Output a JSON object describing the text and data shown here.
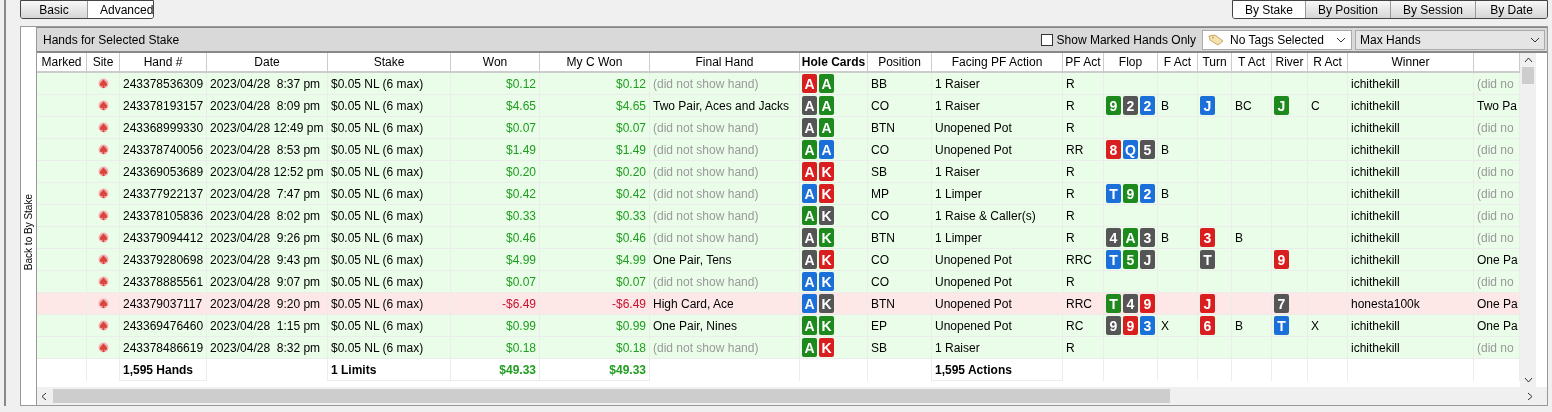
{
  "view_tabs": [
    {
      "label": "Basic",
      "selected": false
    },
    {
      "label": "Advanced",
      "selected": true
    }
  ],
  "group_tabs": [
    {
      "label": "By Stake",
      "selected": true
    },
    {
      "label": "By Position",
      "selected": false
    },
    {
      "label": "By Session",
      "selected": false
    },
    {
      "label": "By Date",
      "selected": false
    }
  ],
  "back_button": "Back to By Stake",
  "panel_title": "Hands for Selected Stake",
  "marked_only": {
    "label": "Show Marked Hands Only",
    "checked": false
  },
  "tags_dropdown": "No Tags Selected",
  "limit_dropdown": "Max Hands",
  "columns": [
    {
      "label": "Marked",
      "sorted": false
    },
    {
      "label": "Site",
      "sorted": false
    },
    {
      "label": "Hand #",
      "sorted": false
    },
    {
      "label": "Date",
      "sorted": false
    },
    {
      "label": "Stake",
      "sorted": false
    },
    {
      "label": "Won",
      "sorted": false
    },
    {
      "label": "My C Won",
      "sorted": false
    },
    {
      "label": "Final Hand",
      "sorted": false
    },
    {
      "label": "Hole Cards",
      "sorted": true
    },
    {
      "label": "Position",
      "sorted": false
    },
    {
      "label": "Facing PF Action",
      "sorted": false
    },
    {
      "label": "PF Act",
      "sorted": false
    },
    {
      "label": "Flop",
      "sorted": false
    },
    {
      "label": "F Act",
      "sorted": false
    },
    {
      "label": "Turn",
      "sorted": false
    },
    {
      "label": "T Act",
      "sorted": false
    },
    {
      "label": "River",
      "sorted": false
    },
    {
      "label": "R Act",
      "sorted": false
    },
    {
      "label": "Winner",
      "sorted": false
    }
  ],
  "rows": [
    {
      "lost": false,
      "hand": "243378536309",
      "date": "2023/04/28  8:37 pm",
      "stake": "$0.05 NL (6 max)",
      "won": "$0.12",
      "my_c_won": "$0.12",
      "final_hand": "(did not show hand)",
      "shown": false,
      "hole_cards": [
        {
          "rank": "A",
          "color": "#d81e1e"
        },
        {
          "rank": "A",
          "color": "#1e8a1e"
        }
      ],
      "position": "BB",
      "facing": "1 Raiser",
      "pf_act": "R",
      "flop": [],
      "f_act": "",
      "turn": [],
      "t_act": "",
      "river": [],
      "r_act": "",
      "winner": "ichithekill",
      "column_20": "(did no"
    },
    {
      "lost": false,
      "hand": "243378193157",
      "date": "2023/04/28  8:09 pm",
      "stake": "$0.05 NL (6 max)",
      "won": "$4.65",
      "my_c_won": "$4.65",
      "final_hand": "Two Pair, Aces and Jacks",
      "shown": true,
      "hole_cards": [
        {
          "rank": "A",
          "color": "#555555"
        },
        {
          "rank": "A",
          "color": "#1e8a1e"
        }
      ],
      "position": "CO",
      "facing": "1 Raiser",
      "pf_act": "R",
      "flop": [
        {
          "rank": "9",
          "color": "#1e8a1e"
        },
        {
          "rank": "2",
          "color": "#555555"
        },
        {
          "rank": "2",
          "color": "#1b6fd8"
        }
      ],
      "f_act": "B",
      "turn": [
        {
          "rank": "J",
          "color": "#1b6fd8"
        }
      ],
      "t_act": "BC",
      "river": [
        {
          "rank": "J",
          "color": "#1e8a1e"
        }
      ],
      "r_act": "C",
      "winner": "ichithekill",
      "column_20": "Two Pa"
    },
    {
      "lost": false,
      "hand": "243368999330",
      "date": "2023/04/28 12:49 pm",
      "stake": "$0.05 NL (6 max)",
      "won": "$0.07",
      "my_c_won": "$0.07",
      "final_hand": "(did not show hand)",
      "shown": false,
      "hole_cards": [
        {
          "rank": "A",
          "color": "#555555"
        },
        {
          "rank": "A",
          "color": "#1e8a1e"
        }
      ],
      "position": "BTN",
      "facing": "Unopened Pot",
      "pf_act": "R",
      "flop": [],
      "f_act": "",
      "turn": [],
      "t_act": "",
      "river": [],
      "r_act": "",
      "winner": "ichithekill",
      "column_20": "(did no"
    },
    {
      "lost": false,
      "hand": "243378740056",
      "date": "2023/04/28  8:53 pm",
      "stake": "$0.05 NL (6 max)",
      "won": "$1.49",
      "my_c_won": "$1.49",
      "final_hand": "(did not show hand)",
      "shown": false,
      "hole_cards": [
        {
          "rank": "A",
          "color": "#1e8a1e"
        },
        {
          "rank": "A",
          "color": "#1b6fd8"
        }
      ],
      "position": "CO",
      "facing": "Unopened Pot",
      "pf_act": "RR",
      "flop": [
        {
          "rank": "8",
          "color": "#d81e1e"
        },
        {
          "rank": "Q",
          "color": "#1b6fd8"
        },
        {
          "rank": "5",
          "color": "#555555"
        }
      ],
      "f_act": "B",
      "turn": [],
      "t_act": "",
      "river": [],
      "r_act": "",
      "winner": "ichithekill",
      "column_20": "(did no"
    },
    {
      "lost": false,
      "hand": "243369053689",
      "date": "2023/04/28 12:52 pm",
      "stake": "$0.05 NL (6 max)",
      "won": "$0.20",
      "my_c_won": "$0.20",
      "final_hand": "(did not show hand)",
      "shown": false,
      "hole_cards": [
        {
          "rank": "A",
          "color": "#d81e1e"
        },
        {
          "rank": "K",
          "color": "#d81e1e"
        }
      ],
      "position": "SB",
      "facing": "1 Raiser",
      "pf_act": "R",
      "flop": [],
      "f_act": "",
      "turn": [],
      "t_act": "",
      "river": [],
      "r_act": "",
      "winner": "ichithekill",
      "column_20": "(did no"
    },
    {
      "lost": false,
      "hand": "243377922137",
      "date": "2023/04/28  7:47 pm",
      "stake": "$0.05 NL (6 max)",
      "won": "$0.42",
      "my_c_won": "$0.42",
      "final_hand": "(did not show hand)",
      "shown": false,
      "hole_cards": [
        {
          "rank": "A",
          "color": "#1b6fd8"
        },
        {
          "rank": "K",
          "color": "#d81e1e"
        }
      ],
      "position": "MP",
      "facing": "1 Limper",
      "pf_act": "R",
      "flop": [
        {
          "rank": "T",
          "color": "#1b6fd8"
        },
        {
          "rank": "9",
          "color": "#1e8a1e"
        },
        {
          "rank": "2",
          "color": "#1b6fd8"
        }
      ],
      "f_act": "B",
      "turn": [],
      "t_act": "",
      "river": [],
      "r_act": "",
      "winner": "ichithekill",
      "column_20": "(did no"
    },
    {
      "lost": false,
      "hand": "243378105836",
      "date": "2023/04/28  8:02 pm",
      "stake": "$0.05 NL (6 max)",
      "won": "$0.33",
      "my_c_won": "$0.33",
      "final_hand": "(did not show hand)",
      "shown": false,
      "hole_cards": [
        {
          "rank": "A",
          "color": "#1e8a1e"
        },
        {
          "rank": "K",
          "color": "#555555"
        }
      ],
      "position": "CO",
      "facing": "1 Raise & Caller(s)",
      "pf_act": "R",
      "flop": [],
      "f_act": "",
      "turn": [],
      "t_act": "",
      "river": [],
      "r_act": "",
      "winner": "ichithekill",
      "column_20": "(did no"
    },
    {
      "lost": false,
      "hand": "243379094412",
      "date": "2023/04/28  9:26 pm",
      "stake": "$0.05 NL (6 max)",
      "won": "$0.46",
      "my_c_won": "$0.46",
      "final_hand": "(did not show hand)",
      "shown": false,
      "hole_cards": [
        {
          "rank": "A",
          "color": "#555555"
        },
        {
          "rank": "K",
          "color": "#1e8a1e"
        }
      ],
      "position": "BTN",
      "facing": "1 Limper",
      "pf_act": "R",
      "flop": [
        {
          "rank": "4",
          "color": "#555555"
        },
        {
          "rank": "A",
          "color": "#1e8a1e"
        },
        {
          "rank": "3",
          "color": "#555555"
        }
      ],
      "f_act": "B",
      "turn": [
        {
          "rank": "3",
          "color": "#d81e1e"
        }
      ],
      "t_act": "B",
      "river": [],
      "r_act": "",
      "winner": "ichithekill",
      "column_20": "(did no"
    },
    {
      "lost": false,
      "hand": "243379280698",
      "date": "2023/04/28  9:43 pm",
      "stake": "$0.05 NL (6 max)",
      "won": "$4.99",
      "my_c_won": "$4.99",
      "final_hand": "One Pair, Tens",
      "shown": true,
      "hole_cards": [
        {
          "rank": "A",
          "color": "#555555"
        },
        {
          "rank": "K",
          "color": "#d81e1e"
        }
      ],
      "position": "CO",
      "facing": "Unopened Pot",
      "pf_act": "RRC",
      "flop": [
        {
          "rank": "T",
          "color": "#1b6fd8"
        },
        {
          "rank": "5",
          "color": "#1e8a1e"
        },
        {
          "rank": "J",
          "color": "#555555"
        }
      ],
      "f_act": "",
      "turn": [
        {
          "rank": "T",
          "color": "#555555"
        }
      ],
      "t_act": "",
      "river": [
        {
          "rank": "9",
          "color": "#d81e1e"
        }
      ],
      "r_act": "",
      "winner": "ichithekill",
      "column_20": "One Pa"
    },
    {
      "lost": false,
      "hand": "243378885561",
      "date": "2023/04/28  9:07 pm",
      "stake": "$0.05 NL (6 max)",
      "won": "$0.07",
      "my_c_won": "$0.07",
      "final_hand": "(did not show hand)",
      "shown": false,
      "hole_cards": [
        {
          "rank": "A",
          "color": "#1b6fd8"
        },
        {
          "rank": "K",
          "color": "#1b6fd8"
        }
      ],
      "position": "CO",
      "facing": "Unopened Pot",
      "pf_act": "R",
      "flop": [],
      "f_act": "",
      "turn": [],
      "t_act": "",
      "river": [],
      "r_act": "",
      "winner": "ichithekill",
      "column_20": "(did no"
    },
    {
      "lost": true,
      "hand": "243379037117",
      "date": "2023/04/28  9:20 pm",
      "stake": "$0.05 NL (6 max)",
      "won": "-$6.49",
      "my_c_won": "-$6.49",
      "final_hand": "High Card, Ace",
      "shown": true,
      "hole_cards": [
        {
          "rank": "A",
          "color": "#1b6fd8"
        },
        {
          "rank": "K",
          "color": "#555555"
        }
      ],
      "position": "BTN",
      "facing": "Unopened Pot",
      "pf_act": "RRC",
      "flop": [
        {
          "rank": "T",
          "color": "#1e8a1e"
        },
        {
          "rank": "4",
          "color": "#555555"
        },
        {
          "rank": "9",
          "color": "#d81e1e"
        }
      ],
      "f_act": "",
      "turn": [
        {
          "rank": "J",
          "color": "#d81e1e"
        }
      ],
      "t_act": "",
      "river": [
        {
          "rank": "7",
          "color": "#555555"
        }
      ],
      "r_act": "",
      "winner": "honesta100k",
      "column_20": "One Pa"
    },
    {
      "lost": false,
      "hand": "243369476460",
      "date": "2023/04/28  1:15 pm",
      "stake": "$0.05 NL (6 max)",
      "won": "$0.99",
      "my_c_won": "$0.99",
      "final_hand": "One Pair, Nines",
      "shown": true,
      "hole_cards": [
        {
          "rank": "A",
          "color": "#1e8a1e"
        },
        {
          "rank": "K",
          "color": "#1e8a1e"
        }
      ],
      "position": "EP",
      "facing": "Unopened Pot",
      "pf_act": "RC",
      "flop": [
        {
          "rank": "9",
          "color": "#555555"
        },
        {
          "rank": "9",
          "color": "#d81e1e"
        },
        {
          "rank": "3",
          "color": "#1b6fd8"
        }
      ],
      "f_act": "X",
      "turn": [
        {
          "rank": "6",
          "color": "#d81e1e"
        }
      ],
      "t_act": "B",
      "river": [
        {
          "rank": "T",
          "color": "#1b6fd8"
        }
      ],
      "r_act": "X",
      "winner": "ichithekill",
      "column_20": "One Pa"
    },
    {
      "lost": false,
      "hand": "243378486619",
      "date": "2023/04/28  8:32 pm",
      "stake": "$0.05 NL (6 max)",
      "won": "$0.18",
      "my_c_won": "$0.18",
      "final_hand": "(did not show hand)",
      "shown": false,
      "hole_cards": [
        {
          "rank": "A",
          "color": "#1e8a1e"
        },
        {
          "rank": "K",
          "color": "#d81e1e"
        }
      ],
      "position": "SB",
      "facing": "1 Raiser",
      "pf_act": "R",
      "flop": [],
      "f_act": "",
      "turn": [],
      "t_act": "",
      "river": [],
      "r_act": "",
      "winner": "ichithekill",
      "column_20": "(did no"
    }
  ],
  "totals": {
    "hand": "1,595 Hands",
    "stake": "1 Limits",
    "won": "$49.33",
    "my_c_won": "$49.33",
    "facing": "1,595 Actions"
  }
}
